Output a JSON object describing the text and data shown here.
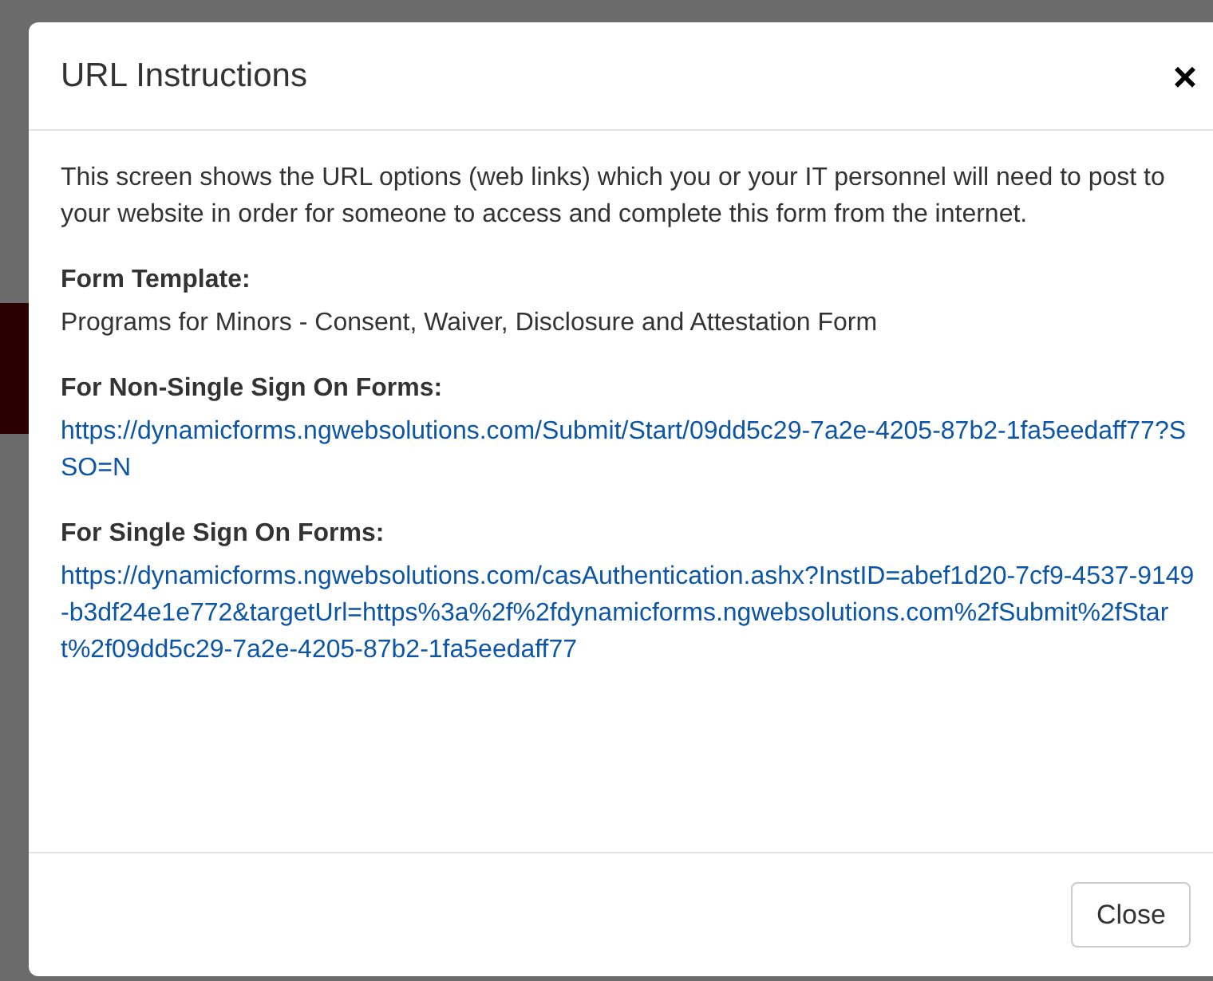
{
  "dialog": {
    "title": "URL Instructions",
    "close_symbol": "×",
    "intro": "This screen shows the URL options (web links) which you or your IT personnel will need to post to your website in order for someone to access and complete this form from the internet.",
    "sections": [
      {
        "kind": "text",
        "label": "Form Template:",
        "value": "Programs for Minors - Consent, Waiver, Disclosure and Attestation Form"
      },
      {
        "kind": "link",
        "label": "For Non-Single Sign On Forms:",
        "value": "https://dynamicforms.ngwebsolutions.com/Submit/Start/09dd5c29-7a2e-4205-87b2-1fa5eedaff77?SSO=N"
      },
      {
        "kind": "link",
        "label": "For Single Sign On Forms:",
        "value": "https://dynamicforms.ngwebsolutions.com/casAuthentication.ashx?InstID=abef1d20-7cf9-4537-9149-b3df24e1e772&targetUrl=https%3a%2f%2fdynamicforms.ngwebsolutions.com%2fSubmit%2fStart%2f09dd5c29-7a2e-4205-87b2-1fa5eedaff77"
      }
    ],
    "buttons": [
      "Close"
    ]
  }
}
